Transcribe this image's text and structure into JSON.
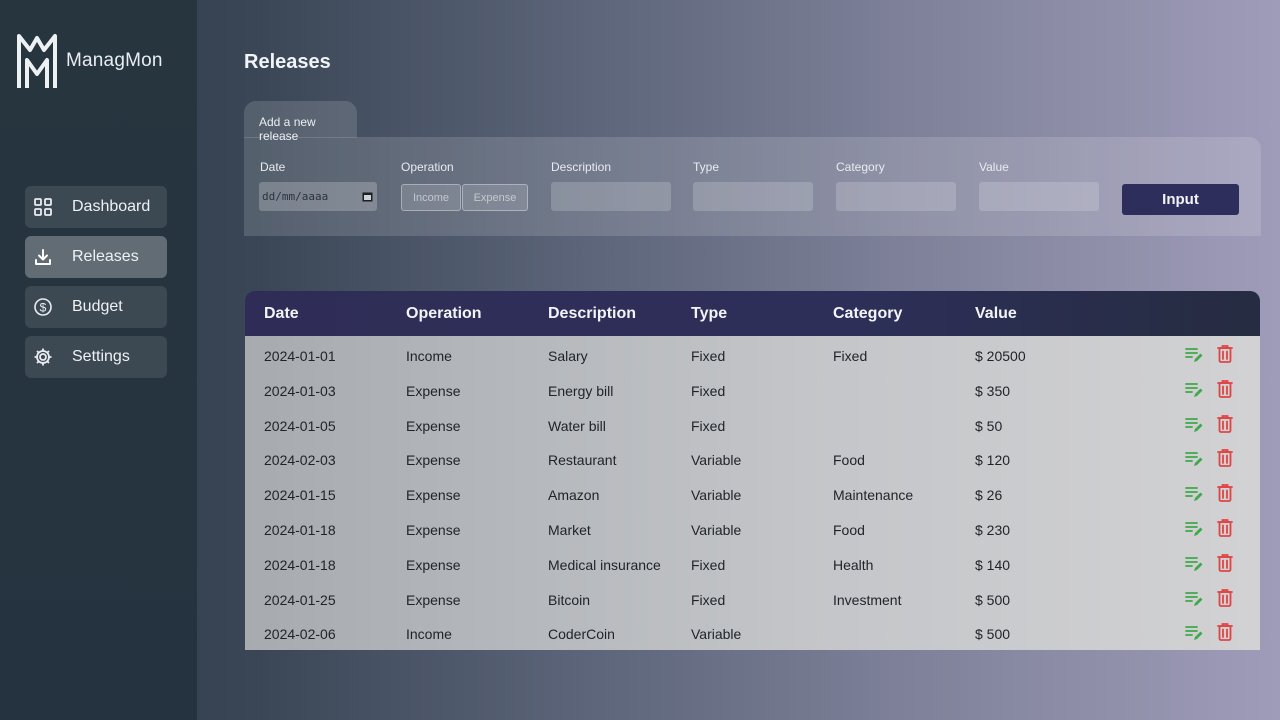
{
  "app": {
    "name": "ManagMon"
  },
  "sidebar": {
    "items": [
      {
        "label": "Dashboard",
        "icon": "grid-icon"
      },
      {
        "label": "Releases",
        "icon": "download-icon"
      },
      {
        "label": "Budget",
        "icon": "dollar-circle-icon"
      },
      {
        "label": "Settings",
        "icon": "gear-icon"
      }
    ]
  },
  "page": {
    "title": "Releases"
  },
  "form": {
    "tab_label": "Add a new release",
    "labels": {
      "date": "Date",
      "operation": "Operation",
      "description": "Description",
      "type": "Type",
      "category": "Category",
      "value": "Value"
    },
    "date_placeholder": "dd/mm/aaaa",
    "operation_options": [
      "Income",
      "Expense"
    ],
    "submit_label": "Input"
  },
  "table": {
    "headers": [
      "Date",
      "Operation",
      "Description",
      "Type",
      "Category",
      "Value"
    ],
    "rows": [
      {
        "date": "2024-01-01",
        "operation": "Income",
        "description": "Salary",
        "type": "Fixed",
        "category": "Fixed",
        "value": "$ 20500"
      },
      {
        "date": "2024-01-03",
        "operation": "Expense",
        "description": "Energy bill",
        "type": "Fixed",
        "category": "",
        "value": "$ 350"
      },
      {
        "date": "2024-01-05",
        "operation": "Expense",
        "description": "Water bill",
        "type": "Fixed",
        "category": "",
        "value": "$ 50"
      },
      {
        "date": "2024-02-03",
        "operation": "Expense",
        "description": "Restaurant",
        "type": "Variable",
        "category": "Food",
        "value": "$ 120"
      },
      {
        "date": "2024-01-15",
        "operation": "Expense",
        "description": "Amazon",
        "type": "Variable",
        "category": "Maintenance",
        "value": "$ 26"
      },
      {
        "date": "2024-01-18",
        "operation": "Expense",
        "description": "Market",
        "type": "Variable",
        "category": "Food",
        "value": "$ 230"
      },
      {
        "date": "2024-01-18",
        "operation": "Expense",
        "description": "Medical insurance",
        "type": "Fixed",
        "category": "Health",
        "value": "$ 140"
      },
      {
        "date": "2024-01-25",
        "operation": "Expense",
        "description": "Bitcoin",
        "type": "Fixed",
        "category": "Investment",
        "value": "$ 500"
      },
      {
        "date": "2024-02-06",
        "operation": "Income",
        "description": "CoderCoin",
        "type": "Variable",
        "category": "",
        "value": "$ 500"
      }
    ]
  },
  "colors": {
    "accent": "#2e2e5c",
    "edit_icon": "#3fa84a",
    "delete_icon": "#e04444"
  }
}
